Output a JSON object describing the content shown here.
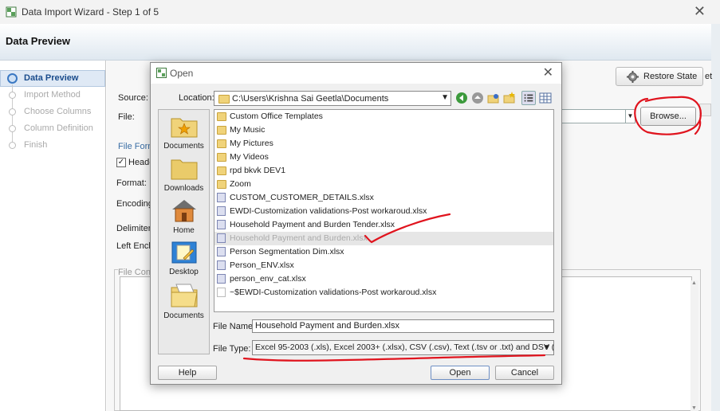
{
  "window": {
    "title": "Data Import Wizard - Step 1 of 5",
    "close_glyph": "✕"
  },
  "header": {
    "title": "Data Preview"
  },
  "steps": [
    {
      "label": "Data Preview",
      "active": true
    },
    {
      "label": "Import Method",
      "active": false
    },
    {
      "label": "Choose Columns",
      "active": false
    },
    {
      "label": "Column Definition",
      "active": false
    },
    {
      "label": "Finish",
      "active": false
    }
  ],
  "toolbar": {
    "restore_state_label": "Restore State",
    "cut_off": "et"
  },
  "form": {
    "source_label": "Source:",
    "file_label": "File:",
    "file_format_label": "File Form",
    "header_checkbox_label": "Heade",
    "header_checked": true,
    "format_label": "Format:",
    "encoding_label": "Encoding:",
    "delimiter_label": "Delimiter:",
    "left_enclosure_label": "Left Enclo",
    "file_contents_label": "File Conte",
    "browse_label": "Browse..."
  },
  "dialog": {
    "title": "Open",
    "location_label": "Location:",
    "location_value": "C:\\Users\\Krishna Sai Geetla\\Documents",
    "places": [
      {
        "label": "Documents",
        "icon": "documents-star-folder-icon"
      },
      {
        "label": "Downloads",
        "icon": "downloads-folder-icon"
      },
      {
        "label": "Home",
        "icon": "home-icon"
      },
      {
        "label": "Desktop",
        "icon": "desktop-icon"
      },
      {
        "label": "Documents",
        "icon": "documents-folder-icon"
      }
    ],
    "files": [
      {
        "name": "Custom Office Templates",
        "kind": "folder"
      },
      {
        "name": "My Music",
        "kind": "folder"
      },
      {
        "name": "My Pictures",
        "kind": "folder"
      },
      {
        "name": "My Videos",
        "kind": "folder"
      },
      {
        "name": "rpd bkvk DEV1",
        "kind": "folder"
      },
      {
        "name": "Zoom",
        "kind": "folder"
      },
      {
        "name": "CUSTOM_CUSTOMER_DETAILS.xlsx",
        "kind": "file"
      },
      {
        "name": "EWDI-Customization validations-Post workaroud.xlsx",
        "kind": "file"
      },
      {
        "name": "Household Payment and Burden Tender.xlsx",
        "kind": "file"
      },
      {
        "name": "Household Payment and Burden.xlsx",
        "kind": "file",
        "selected": true
      },
      {
        "name": "Person Segmentation Dim.xlsx",
        "kind": "file"
      },
      {
        "name": "Person_ENV.xlsx",
        "kind": "file"
      },
      {
        "name": "person_env_cat.xlsx",
        "kind": "file"
      },
      {
        "name": "~$EWDI-Customization validations-Post workaroud.xlsx",
        "kind": "temp"
      }
    ],
    "file_name_label": "File Name:",
    "file_name_value": "Household Payment and Burden.xlsx",
    "file_type_label": "File Type:",
    "file_type_value": "Excel 95-2003 (.xls), Excel 2003+ (.xlsx), CSV (.csv), Text (.tsv or .txt) and DSV (...",
    "help_label": "Help",
    "open_label": "Open",
    "cancel_label": "Cancel",
    "close_glyph": "✕"
  },
  "colors": {
    "annotation_red": "#e0141e",
    "step_active": "#1a4c8c"
  }
}
